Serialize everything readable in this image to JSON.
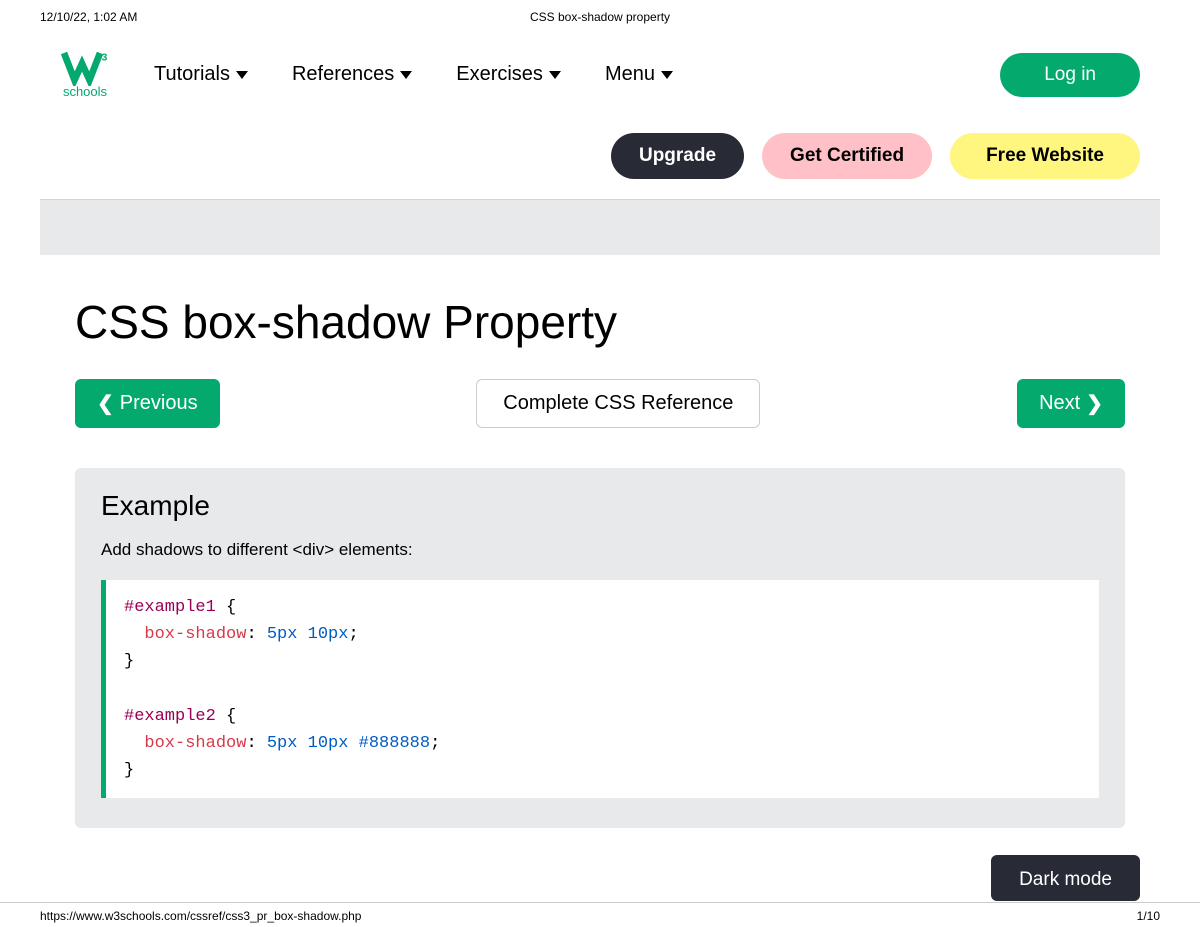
{
  "print": {
    "timestamp": "12/10/22, 1:02 AM",
    "title": "CSS box-shadow property",
    "url": "https://www.w3schools.com/cssref/css3_pr_box-shadow.php",
    "page": "1/10"
  },
  "logo": {
    "text": "schools",
    "sup": "3"
  },
  "nav": {
    "tutorials": "Tutorials",
    "references": "References",
    "exercises": "Exercises",
    "menu": "Menu"
  },
  "login": "Log in",
  "pills": {
    "upgrade": "Upgrade",
    "certified": "Get Certified",
    "freeweb": "Free Website"
  },
  "page_title": "CSS box-shadow Property",
  "navrow": {
    "prev": "Previous",
    "ref": "Complete CSS Reference",
    "next": "Next"
  },
  "example": {
    "heading": "Example",
    "desc": "Add shadows to different <div> elements:",
    "code": {
      "sel1": "#example1",
      "prop": "box-shadow",
      "val1": "5px 10px",
      "sel2": "#example2",
      "val2": "5px 10px #888888"
    }
  },
  "darkmode": "Dark mode"
}
